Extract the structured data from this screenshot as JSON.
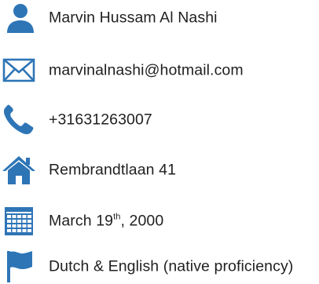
{
  "colors": {
    "icon": "#2e75b6",
    "text": "#1f1f1f"
  },
  "items": [
    {
      "icon": "person-icon",
      "text": "Marvin Hussam Al Nashi"
    },
    {
      "icon": "envelope-icon",
      "text": "marvinalnashi@hotmail.com"
    },
    {
      "icon": "phone-icon",
      "text": "+31631263007"
    },
    {
      "icon": "home-icon",
      "text": "Rembrandtlaan 41"
    },
    {
      "icon": "calendar-icon",
      "text_main": "March 19",
      "text_sup": "th",
      "text_end": ", 2000"
    },
    {
      "icon": "flag-icon",
      "text": "Dutch & English (native proficiency)"
    }
  ]
}
